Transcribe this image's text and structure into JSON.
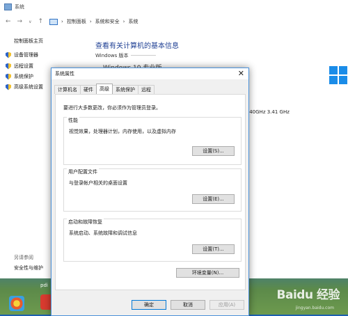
{
  "control_panel": {
    "title": "系统",
    "address": {
      "crumbs": [
        "控制面板",
        "系统和安全",
        "系统"
      ]
    },
    "sidebar": {
      "home": "控制面板主页",
      "items": [
        {
          "label": "设备管理器"
        },
        {
          "label": "远程设置"
        },
        {
          "label": "系统保护"
        },
        {
          "label": "高级系统设置"
        }
      ],
      "see_also": "另请参阅",
      "security_link": "安全性与维护"
    },
    "heading": "查看有关计算机的基本信息",
    "edition_label": "Windows 版本",
    "edition_value": "Windows 10 专业版",
    "cpu_text": ".40GHz   3.41 GHz"
  },
  "dialog": {
    "title": "系统属性",
    "tabs": [
      "计算机名",
      "硬件",
      "高级",
      "系统保护",
      "远程"
    ],
    "active_tab": "高级",
    "admin_note": "要进行大多数更改，你必须作为管理员登录。",
    "groups": {
      "performance": {
        "title": "性能",
        "desc": "视觉效果，处理器计划，内存使用，以及虚拟内存",
        "button": "设置(S)..."
      },
      "profiles": {
        "title": "用户配置文件",
        "desc": "与登录帐户相关的桌面设置",
        "button": "设置(E)..."
      },
      "startup": {
        "title": "启动和故障恢复",
        "desc": "系统启动、系统故障和调试信息",
        "button": "设置(T)..."
      }
    },
    "env_button": "环境变量(N)...",
    "ok": "确定",
    "cancel": "取消",
    "apply": "应用(A)"
  },
  "desktop": {
    "peek_text": "pdi",
    "watermark": "Baidu 经验",
    "watermark_sub": "jingyan.baidu.com"
  },
  "colors": {
    "accent": "#0078d7",
    "heading": "#1e3f93",
    "desktop": "#1b5fb0",
    "win_logo": "#1a8ce8"
  }
}
